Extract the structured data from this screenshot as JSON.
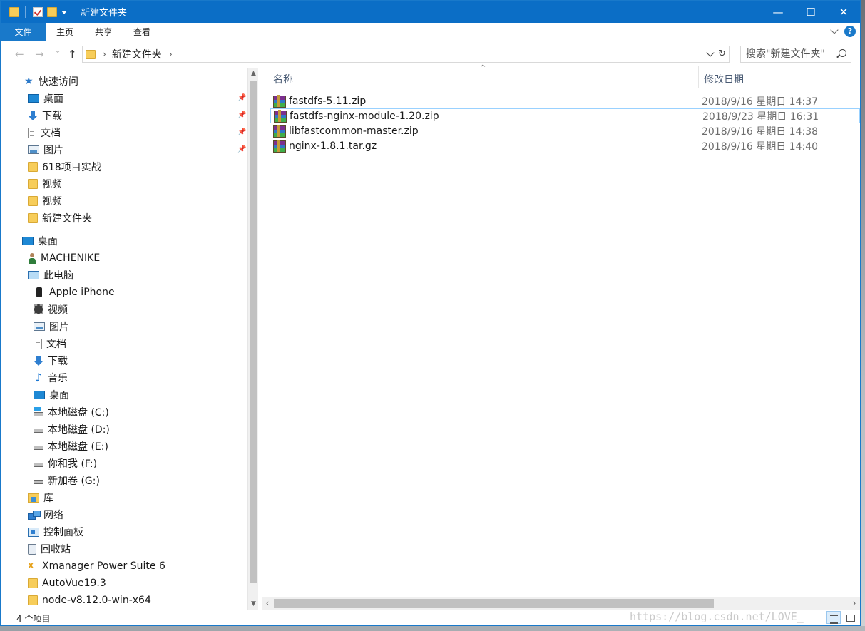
{
  "window": {
    "title": "新建文件夹",
    "controls": {
      "minimize": "—",
      "maximize": "☐",
      "close": "✕"
    },
    "accent_color": "#0b6ec6"
  },
  "ribbon": {
    "tabs": [
      "文件",
      "主页",
      "共享",
      "查看"
    ],
    "help": "?"
  },
  "navigation": {
    "back": "←",
    "forward": "→",
    "recent": "⌄",
    "up": "↑",
    "breadcrumb": [
      "新建文件夹"
    ],
    "refresh": "↻",
    "search_placeholder": "搜索\"新建文件夹\""
  },
  "sidebar": {
    "items": [
      {
        "label": "快速访问",
        "icon": "star-icon",
        "pinned": false
      },
      {
        "label": "桌面",
        "icon": "desktop-icon",
        "pinned": true
      },
      {
        "label": "下载",
        "icon": "download-icon",
        "pinned": true
      },
      {
        "label": "文档",
        "icon": "document-icon",
        "pinned": true
      },
      {
        "label": "图片",
        "icon": "pictures-icon",
        "pinned": true
      },
      {
        "label": "618项目实战",
        "icon": "folder-icon",
        "pinned": false
      },
      {
        "label": "视频",
        "icon": "folder-icon",
        "pinned": false
      },
      {
        "label": "视频",
        "icon": "folder-icon",
        "pinned": false
      },
      {
        "label": "新建文件夹",
        "icon": "folder-icon",
        "pinned": false
      },
      {
        "label": "桌面",
        "icon": "desktop-icon",
        "pinned": false
      },
      {
        "label": "MACHENIKE",
        "icon": "user-icon",
        "pinned": false
      },
      {
        "label": "此电脑",
        "icon": "computer-icon",
        "pinned": false
      },
      {
        "label": "Apple iPhone",
        "icon": "phone-icon",
        "pinned": false
      },
      {
        "label": "视频",
        "icon": "video-icon",
        "pinned": false
      },
      {
        "label": "图片",
        "icon": "pictures-icon",
        "pinned": false
      },
      {
        "label": "文档",
        "icon": "document-icon",
        "pinned": false
      },
      {
        "label": "下载",
        "icon": "download-icon",
        "pinned": false
      },
      {
        "label": "音乐",
        "icon": "music-icon",
        "pinned": false
      },
      {
        "label": "桌面",
        "icon": "desktop-icon",
        "pinned": false
      },
      {
        "label": "本地磁盘 (C:)",
        "icon": "system-drive-icon",
        "pinned": false
      },
      {
        "label": "本地磁盘 (D:)",
        "icon": "drive-icon",
        "pinned": false
      },
      {
        "label": "本地磁盘 (E:)",
        "icon": "drive-icon",
        "pinned": false
      },
      {
        "label": "你和我 (F:)",
        "icon": "drive-icon",
        "pinned": false
      },
      {
        "label": "新加卷 (G:)",
        "icon": "drive-icon",
        "pinned": false
      },
      {
        "label": "库",
        "icon": "library-icon",
        "pinned": false
      },
      {
        "label": "网络",
        "icon": "network-icon",
        "pinned": false
      },
      {
        "label": "控制面板",
        "icon": "control-panel-icon",
        "pinned": false
      },
      {
        "label": "回收站",
        "icon": "recycle-bin-icon",
        "pinned": false
      },
      {
        "label": "Xmanager Power Suite 6",
        "icon": "xmanager-icon",
        "pinned": false
      },
      {
        "label": "AutoVue19.3",
        "icon": "folder-icon",
        "pinned": false
      },
      {
        "label": "node-v8.12.0-win-x64",
        "icon": "folder-icon",
        "pinned": false
      }
    ],
    "pin_glyph": "📌"
  },
  "file_list": {
    "columns": [
      "名称",
      "修改日期"
    ],
    "sort_indicator": "^",
    "files": [
      {
        "name": "fastdfs-5.11.zip",
        "modified": "2018/9/16 星期日 14:37",
        "selected": false
      },
      {
        "name": "fastdfs-nginx-module-1.20.zip",
        "modified": "2018/9/23 星期日 16:31",
        "selected": true
      },
      {
        "name": "libfastcommon-master.zip",
        "modified": "2018/9/16 星期日 14:38",
        "selected": false
      },
      {
        "name": "nginx-1.8.1.tar.gz",
        "modified": "2018/9/16 星期日 14:40",
        "selected": false
      }
    ]
  },
  "status": {
    "item_count": "4 个项目",
    "watermark": "https://blog.csdn.net/LOVE_"
  }
}
